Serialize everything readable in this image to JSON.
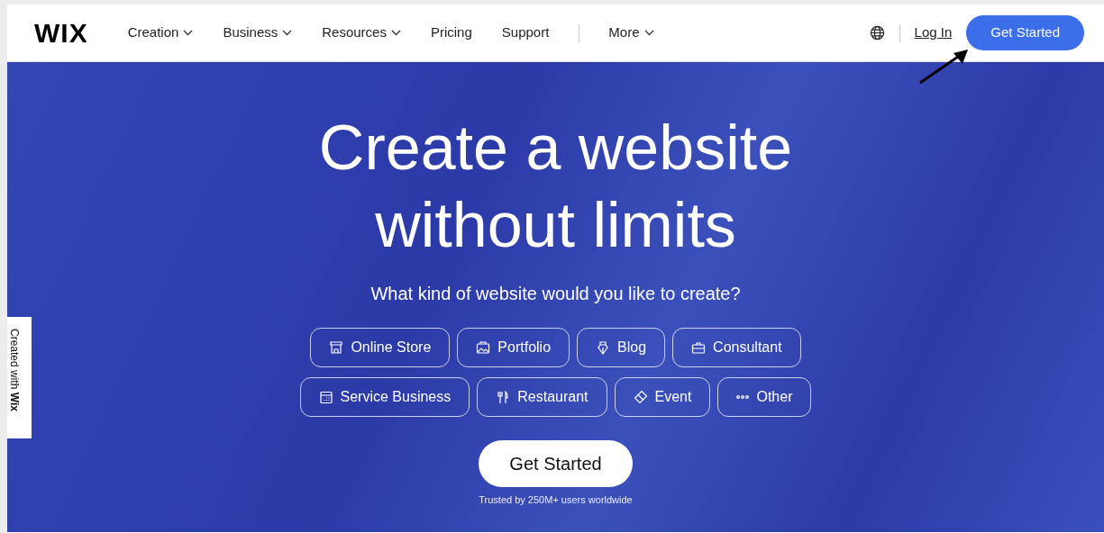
{
  "header": {
    "logo": "WIX",
    "nav": [
      {
        "label": "Creation",
        "dropdown": true
      },
      {
        "label": "Business",
        "dropdown": true
      },
      {
        "label": "Resources",
        "dropdown": true
      },
      {
        "label": "Pricing",
        "dropdown": false
      },
      {
        "label": "Support",
        "dropdown": false
      },
      {
        "label": "More",
        "dropdown": true
      }
    ],
    "login": "Log In",
    "cta": "Get Started"
  },
  "hero": {
    "title": "Create a website without limits",
    "subtitle": "What kind of website would you like to create?",
    "categories": [
      [
        {
          "kind": "store",
          "label": "Online Store"
        },
        {
          "kind": "portfolio",
          "label": "Portfolio"
        },
        {
          "kind": "blog",
          "label": "Blog"
        },
        {
          "kind": "consultant",
          "label": "Consultant"
        }
      ],
      [
        {
          "kind": "service",
          "label": "Service Business"
        },
        {
          "kind": "restaurant",
          "label": "Restaurant"
        },
        {
          "kind": "event",
          "label": "Event"
        },
        {
          "kind": "other",
          "label": "Other"
        }
      ]
    ],
    "cta": "Get Started",
    "trusted": "Trusted by 250M+ users worldwide"
  },
  "side_tab": "Created with **Wix**"
}
